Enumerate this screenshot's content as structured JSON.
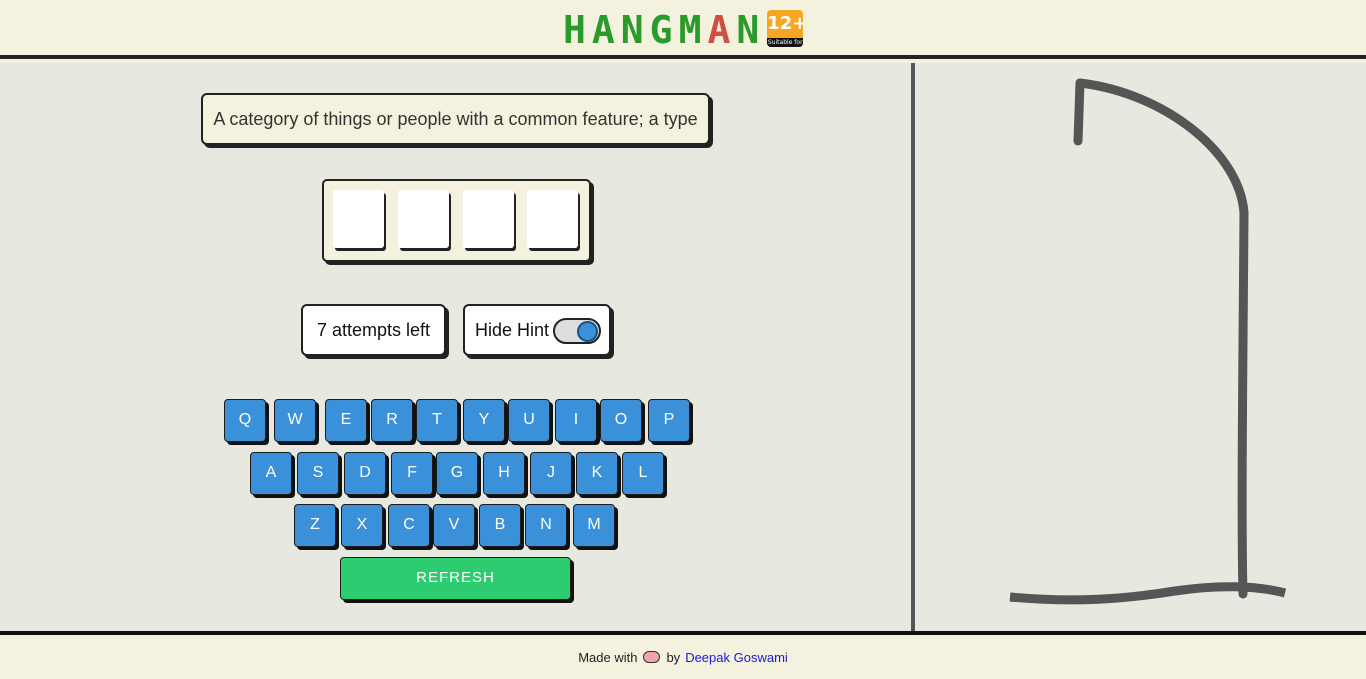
{
  "header": {
    "title_letters": [
      {
        "char": "H",
        "color": "#2a9a2a"
      },
      {
        "char": "A",
        "color": "#2a9a2a"
      },
      {
        "char": "N",
        "color": "#2a9a2a"
      },
      {
        "char": "G",
        "color": "#2a9a2a"
      },
      {
        "char": "M",
        "color": "#2a9a2a"
      },
      {
        "char": "A",
        "color": "#d05040"
      },
      {
        "char": "N",
        "color": "#2a9a2a"
      }
    ],
    "badge_number": "12+",
    "badge_caption": "Suitable for"
  },
  "game": {
    "hint": "A category of things or people with a common feature; a type",
    "word_slots": [
      "",
      "",
      "",
      ""
    ],
    "attempts_text": "7 attempts left",
    "toggle_label": "Hide Hint",
    "toggle_on": true
  },
  "keyboard": {
    "rows": [
      [
        "Q",
        "W",
        "E",
        "R",
        "T",
        "Y",
        "U",
        "I",
        "O",
        "P"
      ],
      [
        "A",
        "S",
        "D",
        "F",
        "G",
        "H",
        "J",
        "K",
        "L"
      ],
      [
        "Z",
        "X",
        "C",
        "V",
        "B",
        "N",
        "M"
      ]
    ],
    "refresh_label": "REFRESH"
  },
  "footer": {
    "made_with": "Made with",
    "by": "by",
    "author": "Deepak Goswami"
  },
  "colors": {
    "key": "#3a90d9",
    "refresh": "#2ecc71",
    "gallows": "#555555"
  }
}
